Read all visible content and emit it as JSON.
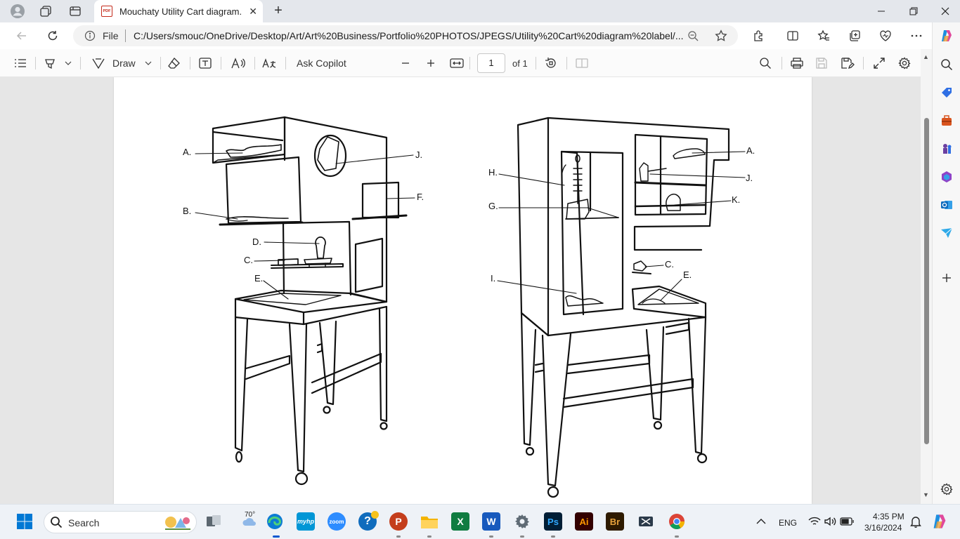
{
  "browser": {
    "tab": {
      "title": "Mouchaty Utility Cart diagram.pdf"
    },
    "address": {
      "label": "File",
      "url": "C:/Users/smouc/OneDrive/Desktop/Art/Art%20Business/Portfolio%20PHOTOS/JPEGS/Utility%20Cart%20diagram%20label/..."
    }
  },
  "pdf_toolbar": {
    "draw_label": "Draw",
    "ask_copilot_label": "Ask Copilot",
    "page_current": "1",
    "page_total": "of 1"
  },
  "diagram": {
    "left_labels": [
      "A.",
      "J.",
      "F.",
      "B.",
      "D.",
      "C.",
      "E."
    ],
    "right_labels": [
      "H.",
      "A.",
      "J.",
      "G.",
      "K.",
      "C.",
      "I.",
      "E."
    ]
  },
  "taskbar": {
    "search_label": "Search",
    "weather": "70°",
    "apps": {
      "zoom": "zoom",
      "myhp": "myhp",
      "ps": "Ps",
      "ai": "Ai",
      "br": "Br"
    },
    "language": "ENG",
    "time": "4:35 PM",
    "date": "3/16/2024"
  },
  "colors": {
    "accent": "#0b57d0",
    "pdf_red": "#c42b1c",
    "tab_bar": "#e4e7ec"
  }
}
